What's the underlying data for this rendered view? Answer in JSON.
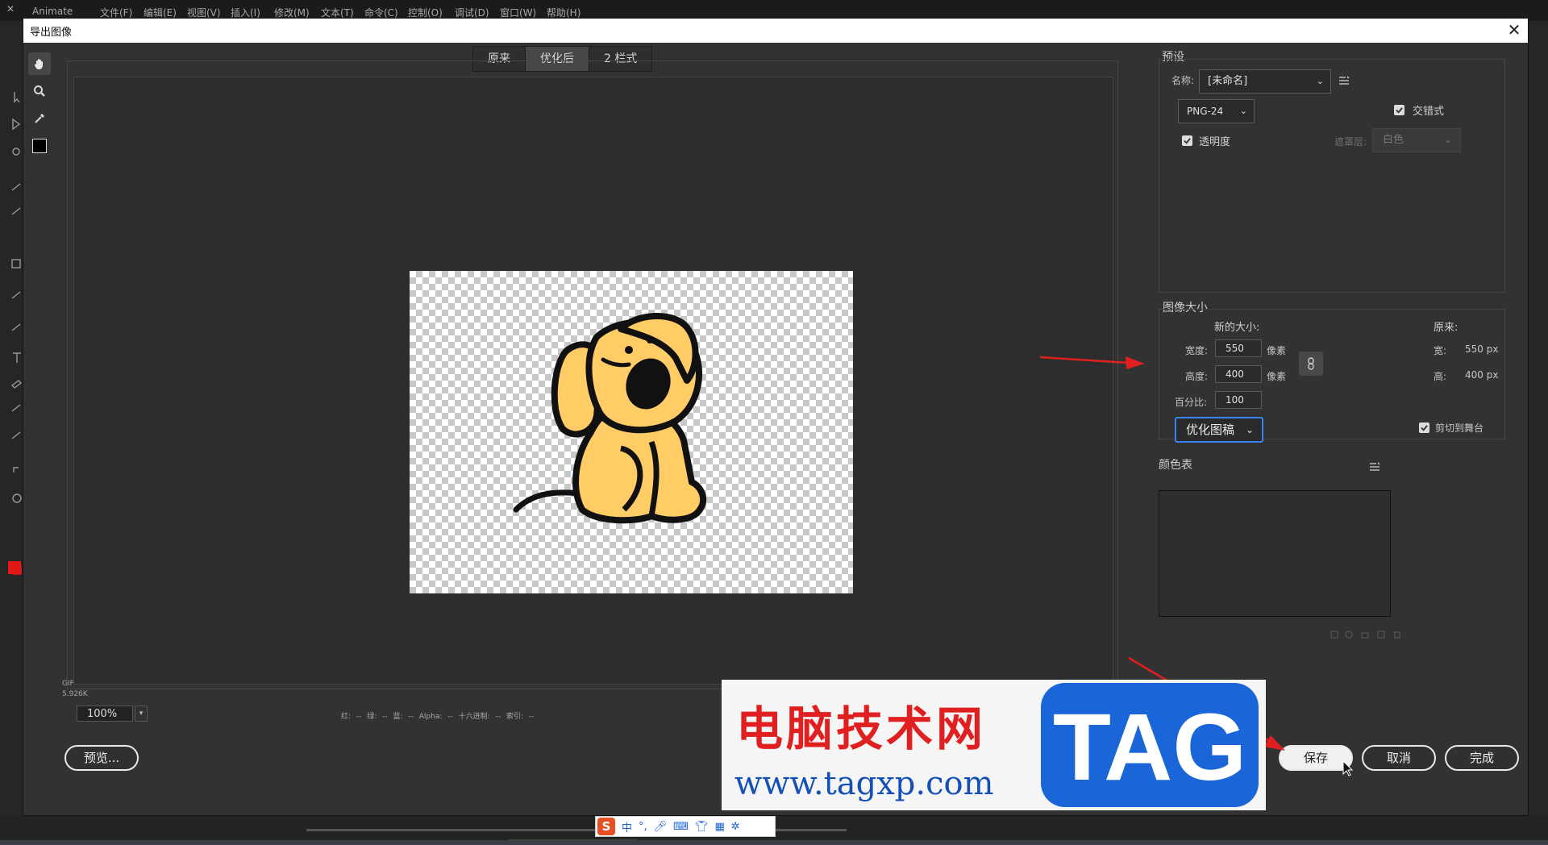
{
  "app": {
    "name": "Animate",
    "menu": [
      "文件(F)",
      "编辑(E)",
      "视图(V)",
      "插入(I)",
      "修改(M)",
      "文本(T)",
      "命令(C)",
      "控制(O)",
      "调试(D)",
      "窗口(W)",
      "帮助(H)"
    ]
  },
  "dialog": {
    "title": "导出图像",
    "tabs": [
      {
        "label": "原来",
        "active": false
      },
      {
        "label": "优化后",
        "active": true
      },
      {
        "label": "2 栏式",
        "active": false
      }
    ],
    "tools": [
      "hand-icon",
      "zoom-icon",
      "eyedropper-icon",
      "color-swatch"
    ],
    "status": {
      "format_line": "GIF",
      "size_line": "5.926K",
      "zoom": "100%",
      "color_readout": "红: --   绿: --   蓝: --   Alpha: --   十六进制: --   索引: --"
    },
    "buttons": {
      "preview": "预览...",
      "save": "保存",
      "cancel": "取消",
      "done": "完成"
    },
    "preset": {
      "title": "预设",
      "name_label": "名称:",
      "name_value": "[未命名]",
      "format_value": "PNG-24",
      "interlaced_label": "交错式",
      "interlaced": true,
      "transparency_label": "透明度",
      "transparency": true,
      "matte_label": "遮罩层:",
      "matte_value": "白色"
    },
    "image_size": {
      "title": "图像大小",
      "new_size_label": "新的大小:",
      "original_label": "原来:",
      "width_label": "宽度:",
      "width_value": "550",
      "height_label": "高度:",
      "height_value": "400",
      "unit": "像素",
      "percent_label": "百分比:",
      "percent_value": "100",
      "orig_width_label": "宽:",
      "orig_width_value": "550 px",
      "orig_height_label": "高:",
      "orig_height_value": "400 px",
      "optimize_value": "优化图稿",
      "clip_label": "剪切到舞台",
      "clip": true
    },
    "color_table": {
      "title": "颜色表"
    }
  },
  "watermark": {
    "title": "电脑技术网",
    "url": "www.tagxp.com",
    "tag": "TAG"
  },
  "ime": {
    "label": "中"
  },
  "colors": {
    "arrow": "#e02020",
    "dog_fill": "#ffcc66",
    "accent_focus": "#3b82f6"
  }
}
